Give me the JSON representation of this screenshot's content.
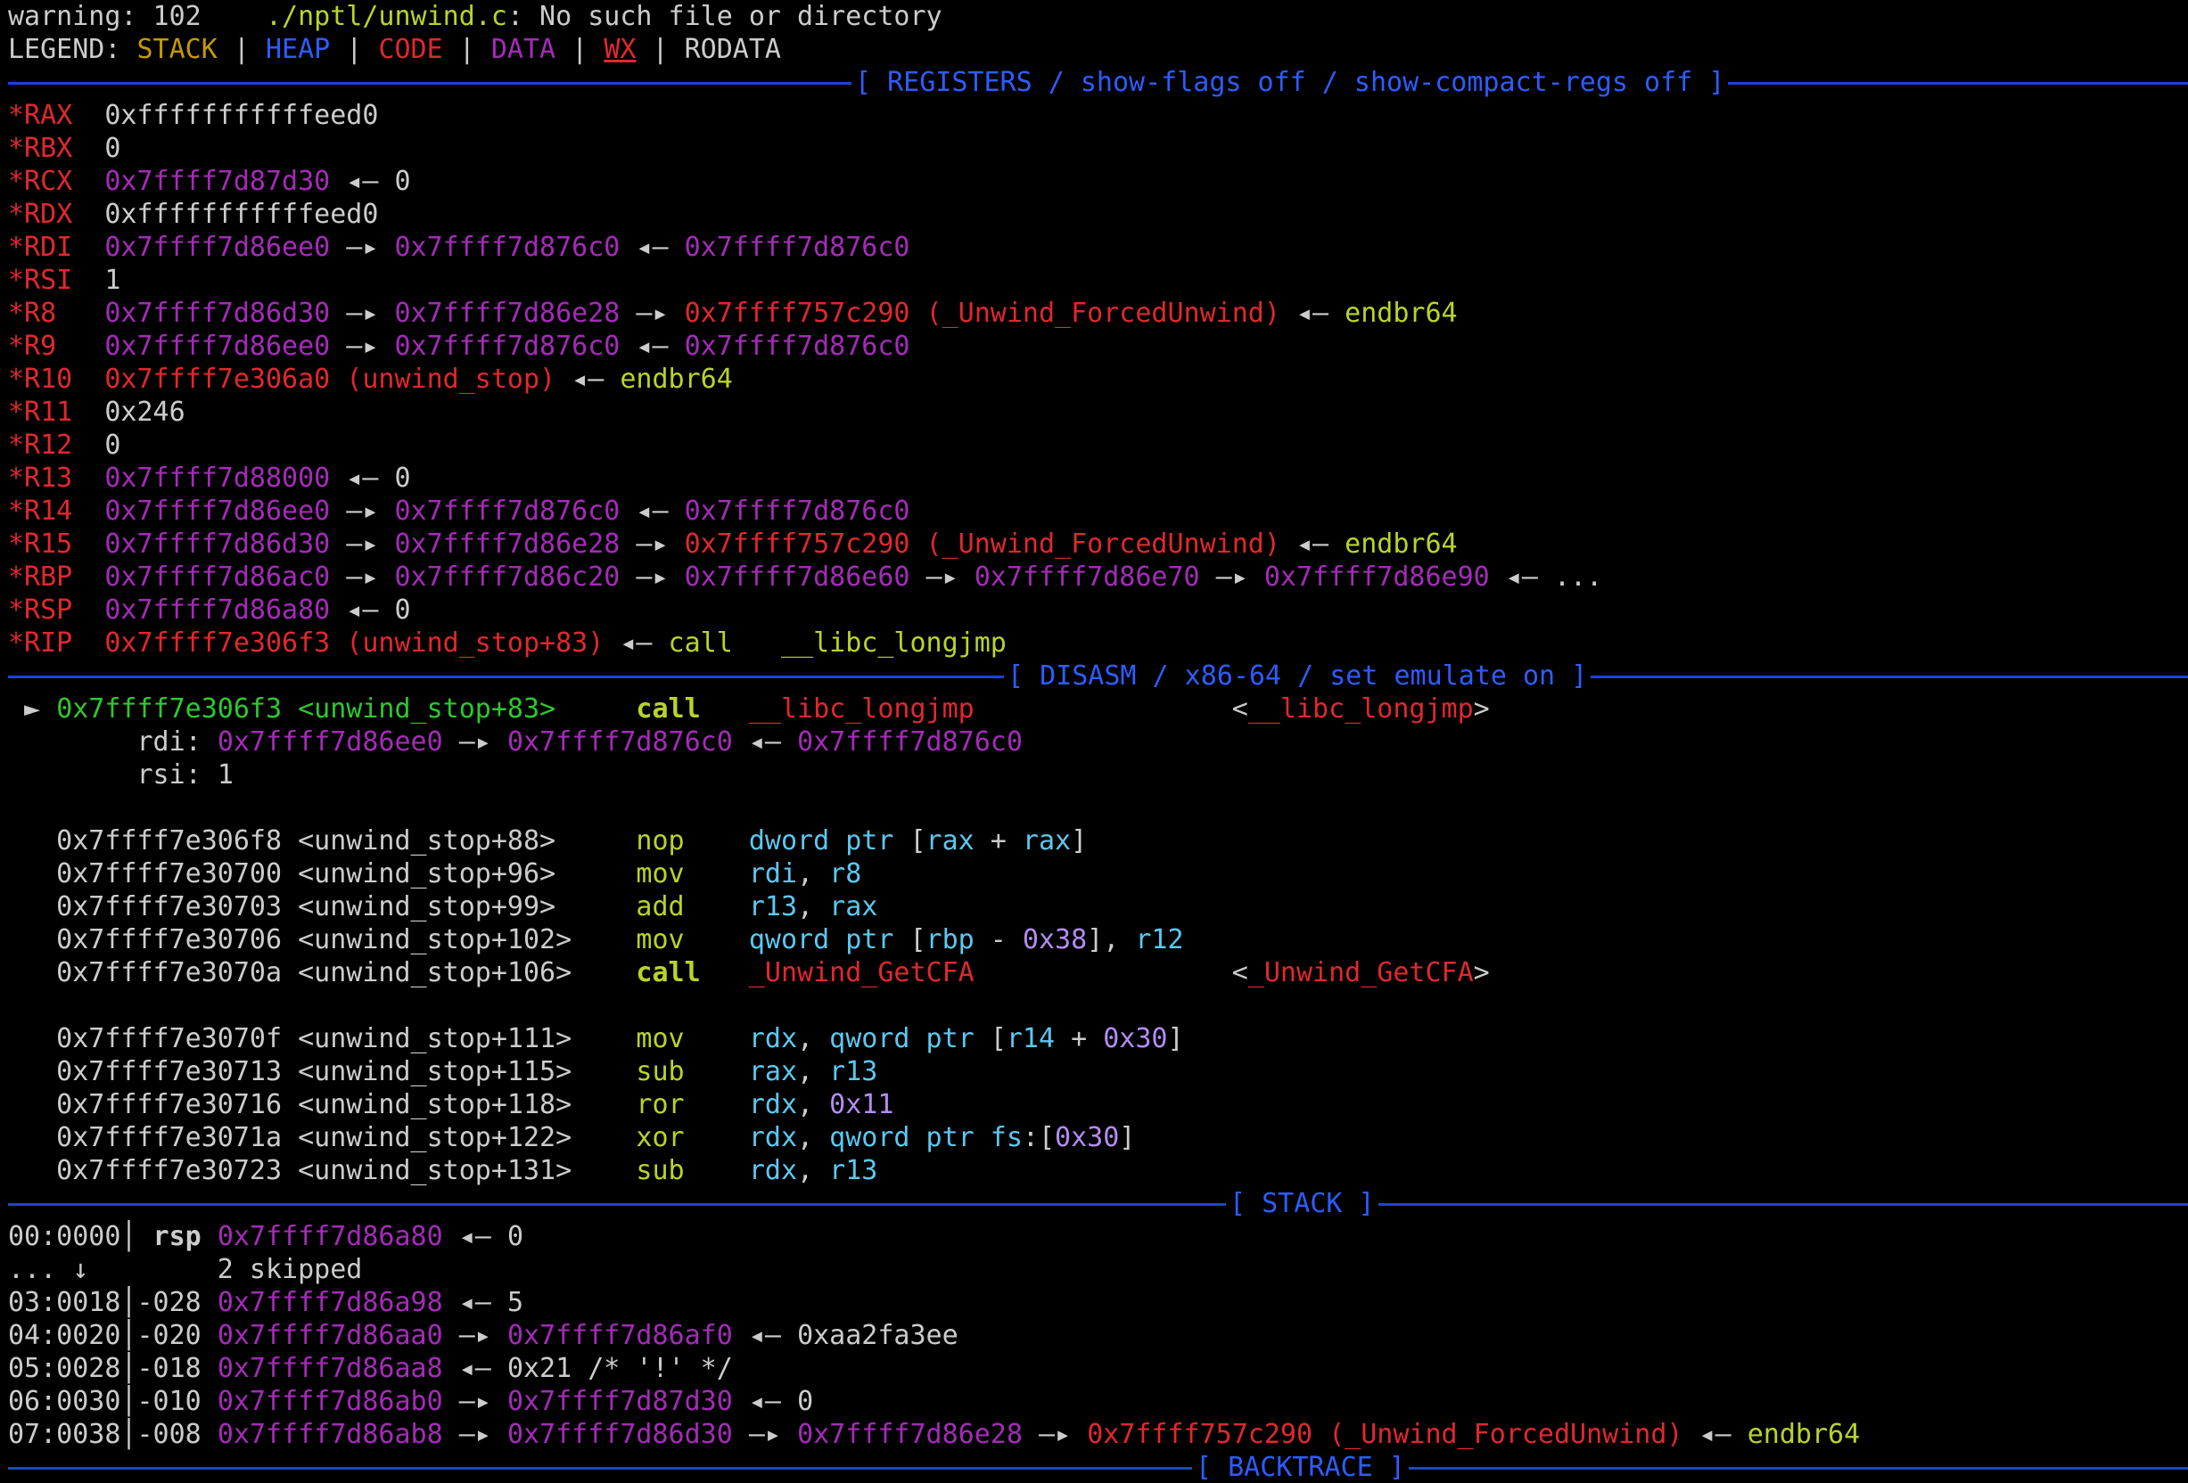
{
  "colors": {
    "background": "#000000",
    "foreground": "#cccccc",
    "stack": "#c49a00",
    "heap": "#2e5cff",
    "code": "#e0282e",
    "data": "#a42bb8",
    "register_name": "#e0282e",
    "string_green": "#b8d42a",
    "current_address": "#2ec82e",
    "separator": "#1a44d8",
    "mnemonic": "#b8d42a",
    "operand": "#5cc8f0",
    "number_literal": "#b48cf0"
  },
  "warning": {
    "prefix": "warning: 102",
    "path": "./nptl/unwind.c",
    "message": ": No such file or directory"
  },
  "legend": {
    "label": "LEGEND: ",
    "sep": " | ",
    "stack": "STACK",
    "heap": "HEAP",
    "code": "CODE",
    "data": "DATA",
    "wx": "WX",
    "rodata": "RODATA"
  },
  "sections": {
    "registers": "[ REGISTERS / show-flags off / show-compact-regs off ]",
    "disasm": "[ DISASM / x86-64 / set emulate on ]",
    "stack": "[ STACK ]",
    "backtrace": "[ BACKTRACE ]"
  },
  "registers": [
    {
      "name": "*RAX",
      "parts": [
        {
          "t": "0xfffffffffffeed0",
          "c": "foreground"
        }
      ]
    },
    {
      "name": "*RBX",
      "parts": [
        {
          "t": "0",
          "c": "foreground"
        }
      ]
    },
    {
      "name": "*RCX",
      "parts": [
        {
          "t": "0x7ffff7d87d30",
          "c": "data"
        },
        {
          "t": " ◂— ",
          "c": "foreground"
        },
        {
          "t": "0",
          "c": "foreground"
        }
      ]
    },
    {
      "name": "*RDX",
      "parts": [
        {
          "t": "0xfffffffffffeed0",
          "c": "foreground"
        }
      ]
    },
    {
      "name": "*RDI",
      "parts": [
        {
          "t": "0x7ffff7d86ee0",
          "c": "data"
        },
        {
          "t": " —▸ ",
          "c": "foreground"
        },
        {
          "t": "0x7ffff7d876c0",
          "c": "data"
        },
        {
          "t": " ◂— ",
          "c": "foreground"
        },
        {
          "t": "0x7ffff7d876c0",
          "c": "data"
        }
      ]
    },
    {
      "name": "*RSI",
      "parts": [
        {
          "t": "1",
          "c": "foreground"
        }
      ]
    },
    {
      "name": "*R8 ",
      "parts": [
        {
          "t": "0x7ffff7d86d30",
          "c": "data"
        },
        {
          "t": " —▸ ",
          "c": "foreground"
        },
        {
          "t": "0x7ffff7d86e28",
          "c": "data"
        },
        {
          "t": " —▸ ",
          "c": "foreground"
        },
        {
          "t": "0x7ffff757c290 (_Unwind_ForcedUnwind)",
          "c": "code"
        },
        {
          "t": " ◂— ",
          "c": "foreground"
        },
        {
          "t": "endbr64",
          "c": "string_green"
        }
      ]
    },
    {
      "name": "*R9 ",
      "parts": [
        {
          "t": "0x7ffff7d86ee0",
          "c": "data"
        },
        {
          "t": " —▸ ",
          "c": "foreground"
        },
        {
          "t": "0x7ffff7d876c0",
          "c": "data"
        },
        {
          "t": " ◂— ",
          "c": "foreground"
        },
        {
          "t": "0x7ffff7d876c0",
          "c": "data"
        }
      ]
    },
    {
      "name": "*R10",
      "parts": [
        {
          "t": "0x7ffff7e306a0 (unwind_stop)",
          "c": "code"
        },
        {
          "t": " ◂— ",
          "c": "foreground"
        },
        {
          "t": "endbr64",
          "c": "string_green"
        }
      ]
    },
    {
      "name": "*R11",
      "parts": [
        {
          "t": "0x246",
          "c": "foreground"
        }
      ]
    },
    {
      "name": "*R12",
      "parts": [
        {
          "t": "0",
          "c": "foreground"
        }
      ]
    },
    {
      "name": "*R13",
      "parts": [
        {
          "t": "0x7ffff7d88000",
          "c": "data"
        },
        {
          "t": " ◂— ",
          "c": "foreground"
        },
        {
          "t": "0",
          "c": "foreground"
        }
      ]
    },
    {
      "name": "*R14",
      "parts": [
        {
          "t": "0x7ffff7d86ee0",
          "c": "data"
        },
        {
          "t": " —▸ ",
          "c": "foreground"
        },
        {
          "t": "0x7ffff7d876c0",
          "c": "data"
        },
        {
          "t": " ◂— ",
          "c": "foreground"
        },
        {
          "t": "0x7ffff7d876c0",
          "c": "data"
        }
      ]
    },
    {
      "name": "*R15",
      "parts": [
        {
          "t": "0x7ffff7d86d30",
          "c": "data"
        },
        {
          "t": " —▸ ",
          "c": "foreground"
        },
        {
          "t": "0x7ffff7d86e28",
          "c": "data"
        },
        {
          "t": " —▸ ",
          "c": "foreground"
        },
        {
          "t": "0x7ffff757c290 (_Unwind_ForcedUnwind)",
          "c": "code"
        },
        {
          "t": " ◂— ",
          "c": "foreground"
        },
        {
          "t": "endbr64",
          "c": "string_green"
        }
      ]
    },
    {
      "name": "*RBP",
      "parts": [
        {
          "t": "0x7ffff7d86ac0",
          "c": "data"
        },
        {
          "t": " —▸ ",
          "c": "foreground"
        },
        {
          "t": "0x7ffff7d86c20",
          "c": "data"
        },
        {
          "t": " —▸ ",
          "c": "foreground"
        },
        {
          "t": "0x7ffff7d86e60",
          "c": "data"
        },
        {
          "t": " —▸ ",
          "c": "foreground"
        },
        {
          "t": "0x7ffff7d86e70",
          "c": "data"
        },
        {
          "t": " —▸ ",
          "c": "foreground"
        },
        {
          "t": "0x7ffff7d86e90",
          "c": "data"
        },
        {
          "t": " ◂— ",
          "c": "foreground"
        },
        {
          "t": "...",
          "c": "foreground"
        }
      ]
    },
    {
      "name": "*RSP",
      "parts": [
        {
          "t": "0x7ffff7d86a80",
          "c": "data"
        },
        {
          "t": " ◂— ",
          "c": "foreground"
        },
        {
          "t": "0",
          "c": "foreground"
        }
      ]
    },
    {
      "name": "*RIP",
      "parts": [
        {
          "t": "0x7ffff7e306f3 (unwind_stop+83)",
          "c": "code"
        },
        {
          "t": " ◂— ",
          "c": "foreground"
        },
        {
          "t": "call   __libc_longjmp",
          "c": "string_green"
        }
      ]
    }
  ],
  "disasm": [
    {
      "parts": [
        {
          "t": " ► ",
          "c": "foreground"
        },
        {
          "t": "0x7ffff7e306f3 <unwind_stop+83>",
          "c": "current_address"
        },
        {
          "t": "     ",
          "c": "foreground"
        },
        {
          "t": "call",
          "c": "mnemonic",
          "b": true
        },
        {
          "t": "   ",
          "c": "foreground"
        },
        {
          "t": "__libc_longjmp",
          "c": "code"
        },
        {
          "t": "                <",
          "c": "foreground"
        },
        {
          "t": "__libc_longjmp",
          "c": "code"
        },
        {
          "t": ">",
          "c": "foreground"
        }
      ]
    },
    {
      "parts": [
        {
          "t": "        rdi",
          "c": "foreground"
        },
        {
          "t": ": ",
          "c": "foreground"
        },
        {
          "t": "0x7ffff7d86ee0",
          "c": "data"
        },
        {
          "t": " —▸ ",
          "c": "foreground"
        },
        {
          "t": "0x7ffff7d876c0",
          "c": "data"
        },
        {
          "t": " ◂— ",
          "c": "foreground"
        },
        {
          "t": "0x7ffff7d876c0",
          "c": "data"
        }
      ]
    },
    {
      "parts": [
        {
          "t": "        rsi",
          "c": "foreground"
        },
        {
          "t": ": ",
          "c": "foreground"
        },
        {
          "t": "1",
          "c": "foreground"
        }
      ]
    },
    {
      "parts": []
    },
    {
      "parts": [
        {
          "t": "   0x7ffff7e306f8 <unwind_stop+88>     ",
          "c": "foreground"
        },
        {
          "t": "nop",
          "c": "mnemonic"
        },
        {
          "t": "    ",
          "c": "foreground"
        },
        {
          "t": "dword ptr",
          "c": "operand"
        },
        {
          "t": " [",
          "c": "foreground"
        },
        {
          "t": "rax",
          "c": "operand"
        },
        {
          "t": " + ",
          "c": "foreground"
        },
        {
          "t": "rax",
          "c": "operand"
        },
        {
          "t": "]",
          "c": "foreground"
        }
      ]
    },
    {
      "parts": [
        {
          "t": "   0x7ffff7e30700 <unwind_stop+96>     ",
          "c": "foreground"
        },
        {
          "t": "mov",
          "c": "mnemonic"
        },
        {
          "t": "    ",
          "c": "foreground"
        },
        {
          "t": "rdi",
          "c": "operand"
        },
        {
          "t": ", ",
          "c": "foreground"
        },
        {
          "t": "r8",
          "c": "operand"
        }
      ]
    },
    {
      "parts": [
        {
          "t": "   0x7ffff7e30703 <unwind_stop+99>     ",
          "c": "foreground"
        },
        {
          "t": "add",
          "c": "mnemonic"
        },
        {
          "t": "    ",
          "c": "foreground"
        },
        {
          "t": "r13",
          "c": "operand"
        },
        {
          "t": ", ",
          "c": "foreground"
        },
        {
          "t": "rax",
          "c": "operand"
        }
      ]
    },
    {
      "parts": [
        {
          "t": "   0x7ffff7e30706 <unwind_stop+102>    ",
          "c": "foreground"
        },
        {
          "t": "mov",
          "c": "mnemonic"
        },
        {
          "t": "    ",
          "c": "foreground"
        },
        {
          "t": "qword ptr",
          "c": "operand"
        },
        {
          "t": " [",
          "c": "foreground"
        },
        {
          "t": "rbp",
          "c": "operand"
        },
        {
          "t": " - ",
          "c": "foreground"
        },
        {
          "t": "0x38",
          "c": "number_literal"
        },
        {
          "t": "], ",
          "c": "foreground"
        },
        {
          "t": "r12",
          "c": "operand"
        }
      ]
    },
    {
      "parts": [
        {
          "t": "   0x7ffff7e3070a <unwind_stop+106>    ",
          "c": "foreground"
        },
        {
          "t": "call",
          "c": "mnemonic",
          "b": true
        },
        {
          "t": "   ",
          "c": "foreground"
        },
        {
          "t": "_Unwind_GetCFA",
          "c": "code"
        },
        {
          "t": "                <",
          "c": "foreground"
        },
        {
          "t": "_Unwind_GetCFA",
          "c": "code"
        },
        {
          "t": ">",
          "c": "foreground"
        }
      ]
    },
    {
      "parts": []
    },
    {
      "parts": [
        {
          "t": "   0x7ffff7e3070f <unwind_stop+111>    ",
          "c": "foreground"
        },
        {
          "t": "mov",
          "c": "mnemonic"
        },
        {
          "t": "    ",
          "c": "foreground"
        },
        {
          "t": "rdx",
          "c": "operand"
        },
        {
          "t": ", ",
          "c": "foreground"
        },
        {
          "t": "qword ptr",
          "c": "operand"
        },
        {
          "t": " [",
          "c": "foreground"
        },
        {
          "t": "r14",
          "c": "operand"
        },
        {
          "t": " + ",
          "c": "foreground"
        },
        {
          "t": "0x30",
          "c": "number_literal"
        },
        {
          "t": "]",
          "c": "foreground"
        }
      ]
    },
    {
      "parts": [
        {
          "t": "   0x7ffff7e30713 <unwind_stop+115>    ",
          "c": "foreground"
        },
        {
          "t": "sub",
          "c": "mnemonic"
        },
        {
          "t": "    ",
          "c": "foreground"
        },
        {
          "t": "rax",
          "c": "operand"
        },
        {
          "t": ", ",
          "c": "foreground"
        },
        {
          "t": "r13",
          "c": "operand"
        }
      ]
    },
    {
      "parts": [
        {
          "t": "   0x7ffff7e30716 <unwind_stop+118>    ",
          "c": "foreground"
        },
        {
          "t": "ror",
          "c": "mnemonic"
        },
        {
          "t": "    ",
          "c": "foreground"
        },
        {
          "t": "rdx",
          "c": "operand"
        },
        {
          "t": ", ",
          "c": "foreground"
        },
        {
          "t": "0x11",
          "c": "number_literal"
        }
      ]
    },
    {
      "parts": [
        {
          "t": "   0x7ffff7e3071a <unwind_stop+122>    ",
          "c": "foreground"
        },
        {
          "t": "xor",
          "c": "mnemonic"
        },
        {
          "t": "    ",
          "c": "foreground"
        },
        {
          "t": "rdx",
          "c": "operand"
        },
        {
          "t": ", ",
          "c": "foreground"
        },
        {
          "t": "qword ptr",
          "c": "operand"
        },
        {
          "t": " ",
          "c": "foreground"
        },
        {
          "t": "fs",
          "c": "operand"
        },
        {
          "t": ":[",
          "c": "foreground"
        },
        {
          "t": "0x30",
          "c": "number_literal"
        },
        {
          "t": "]",
          "c": "foreground"
        }
      ]
    },
    {
      "parts": [
        {
          "t": "   0x7ffff7e30723 <unwind_stop+131>    ",
          "c": "foreground"
        },
        {
          "t": "sub",
          "c": "mnemonic"
        },
        {
          "t": "    ",
          "c": "foreground"
        },
        {
          "t": "rdx",
          "c": "operand"
        },
        {
          "t": ", ",
          "c": "foreground"
        },
        {
          "t": "r13",
          "c": "operand"
        }
      ]
    }
  ],
  "stack": [
    {
      "parts": [
        {
          "t": "00:0000│ ",
          "c": "foreground"
        },
        {
          "t": "rsp",
          "c": "foreground",
          "b": true
        },
        {
          "t": " ",
          "c": "foreground"
        },
        {
          "t": "0x7ffff7d86a80",
          "c": "data"
        },
        {
          "t": " ◂— ",
          "c": "foreground"
        },
        {
          "t": "0",
          "c": "foreground"
        }
      ]
    },
    {
      "parts": [
        {
          "t": "... ↓        2 skipped",
          "c": "foreground"
        }
      ]
    },
    {
      "parts": [
        {
          "t": "03:0018│-028 ",
          "c": "foreground"
        },
        {
          "t": "0x7ffff7d86a98",
          "c": "data"
        },
        {
          "t": " ◂— ",
          "c": "foreground"
        },
        {
          "t": "5",
          "c": "foreground"
        }
      ]
    },
    {
      "parts": [
        {
          "t": "04:0020│-020 ",
          "c": "foreground"
        },
        {
          "t": "0x7ffff7d86aa0",
          "c": "data"
        },
        {
          "t": " —▸ ",
          "c": "foreground"
        },
        {
          "t": "0x7ffff7d86af0",
          "c": "data"
        },
        {
          "t": " ◂— ",
          "c": "foreground"
        },
        {
          "t": "0xaa2fa3ee",
          "c": "foreground"
        }
      ]
    },
    {
      "parts": [
        {
          "t": "05:0028│-018 ",
          "c": "foreground"
        },
        {
          "t": "0x7ffff7d86aa8",
          "c": "data"
        },
        {
          "t": " ◂— ",
          "c": "foreground"
        },
        {
          "t": "0x21 /* '!' */",
          "c": "foreground"
        }
      ]
    },
    {
      "parts": [
        {
          "t": "06:0030│-010 ",
          "c": "foreground"
        },
        {
          "t": "0x7ffff7d86ab0",
          "c": "data"
        },
        {
          "t": " —▸ ",
          "c": "foreground"
        },
        {
          "t": "0x7ffff7d87d30",
          "c": "data"
        },
        {
          "t": " ◂— ",
          "c": "foreground"
        },
        {
          "t": "0",
          "c": "foreground"
        }
      ]
    },
    {
      "parts": [
        {
          "t": "07:0038│-008 ",
          "c": "foreground"
        },
        {
          "t": "0x7ffff7d86ab8",
          "c": "data"
        },
        {
          "t": " —▸ ",
          "c": "foreground"
        },
        {
          "t": "0x7ffff7d86d30",
          "c": "data"
        },
        {
          "t": " —▸ ",
          "c": "foreground"
        },
        {
          "t": "0x7ffff7d86e28",
          "c": "data"
        },
        {
          "t": " —▸ ",
          "c": "foreground"
        },
        {
          "t": "0x7ffff757c290 (_Unwind_ForcedUnwind)",
          "c": "code"
        },
        {
          "t": " ◂— ",
          "c": "foreground"
        },
        {
          "t": "endbr64",
          "c": "string_green"
        }
      ]
    }
  ]
}
